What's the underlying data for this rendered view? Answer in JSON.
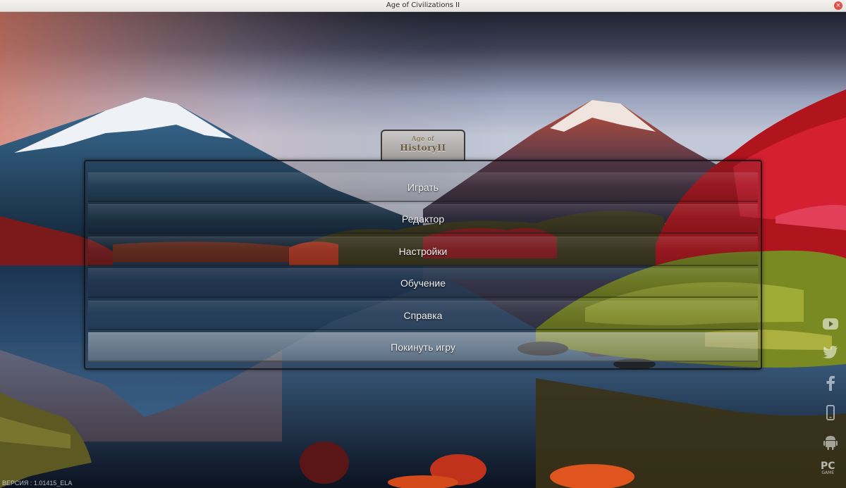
{
  "window": {
    "title": "Age of Civilizations II",
    "close_symbol": "×"
  },
  "logo": {
    "line1": "Age of",
    "line2": "HistoryII"
  },
  "menu": {
    "items": [
      {
        "label": "Играть"
      },
      {
        "label": "Редактор"
      },
      {
        "label": "Настройки"
      },
      {
        "label": "Обучение"
      },
      {
        "label": "Справка"
      },
      {
        "label": "Покинуть игру"
      }
    ]
  },
  "side_icons": [
    "youtube-icon",
    "twitter-icon",
    "facebook-icon",
    "mobile-icon",
    "android-icon"
  ],
  "pc_badge": {
    "line1": "PC",
    "line2": "GAME"
  },
  "version": "ВЕРСИЯ : 1.01415_ELA",
  "colors": {
    "titlebar": "#eceae6",
    "close_button": "#e0504a",
    "menu_text": "#f1f1f1",
    "logo_text": "#6a5a3e"
  }
}
